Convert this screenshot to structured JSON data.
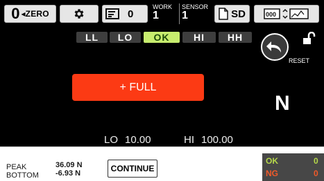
{
  "toolbar": {
    "zero": {
      "symbol": "0",
      "label": "◂ZERO"
    },
    "settings": {
      "icon": "gear-icon"
    },
    "display": {
      "icon": "display-icon",
      "value": "0"
    },
    "work": {
      "label": "WORK",
      "value": "1"
    },
    "sensor": {
      "label": "SENSOR",
      "value": "1"
    },
    "sd": {
      "icon": "file-icon",
      "label": "SD"
    },
    "mode": {
      "icon": "counter-graph-icon"
    }
  },
  "judgement": {
    "items": [
      "LL",
      "LO",
      "OK",
      "HI",
      "HH"
    ],
    "active": "OK",
    "active_color": "#c7ec6e"
  },
  "reset": {
    "label": "RESET",
    "icon": "reset-arrow-icon"
  },
  "lock": {
    "icon": "unlock-icon"
  },
  "measurement": {
    "full_label": "+ FULL",
    "full_color": "#fc3a14",
    "unit": "N"
  },
  "limits": {
    "lo_label": "LO",
    "lo_value": "10.00",
    "hi_label": "HI",
    "hi_value": "100.00"
  },
  "bottom": {
    "peak_label": "PEAK",
    "peak_value": "36.09 N",
    "bottom_label": "BOTTOM",
    "bottom_value": "-6.93 N",
    "continue_label": "CONTINUE",
    "ok_label": "OK",
    "ok_count": "0",
    "ng_label": "NG",
    "ng_count": "0"
  }
}
